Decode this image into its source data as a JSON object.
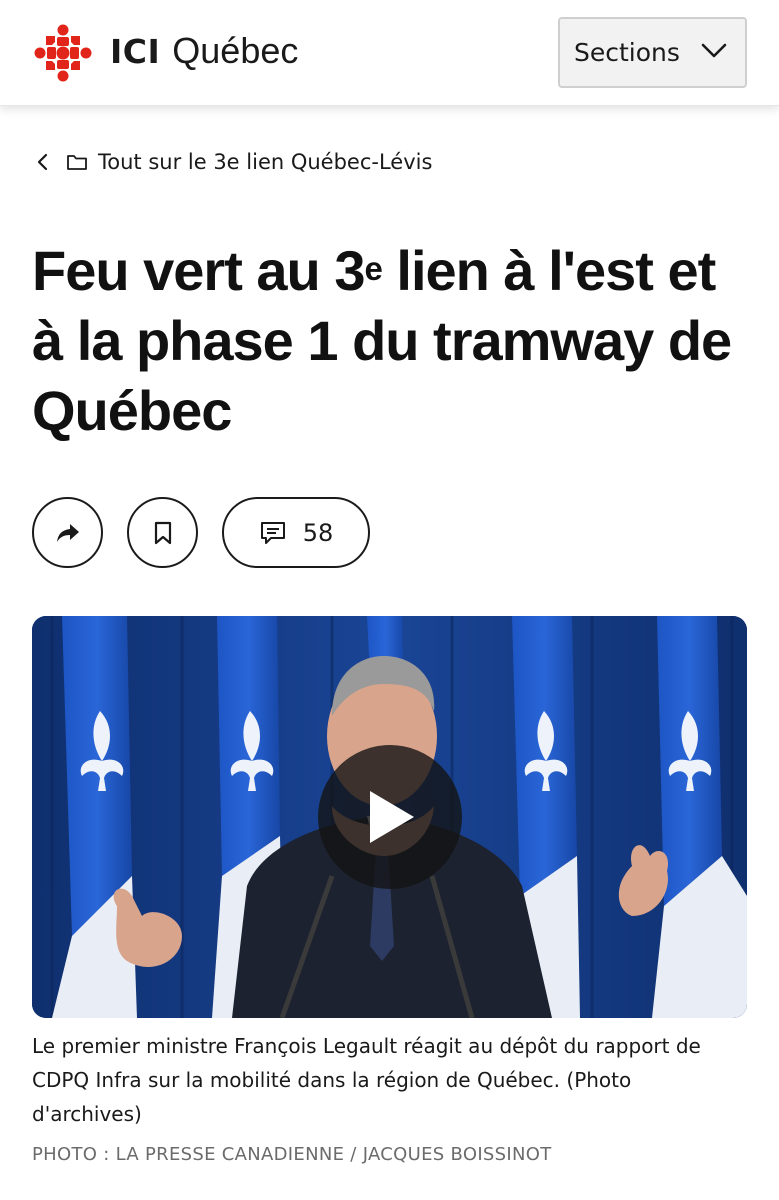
{
  "header": {
    "brand_short": "ICI",
    "brand_region": "Québec",
    "sections_label": "Sections"
  },
  "breadcrumb": {
    "label": "Tout sur le 3e lien Québec-Lévis"
  },
  "article": {
    "title_part1": "Feu vert au 3",
    "title_sup": "e",
    "title_part2": " lien à l'est et à la phase 1 du tramway de Québec",
    "comments_count": "58"
  },
  "media": {
    "caption": "Le premier ministre François Legault réagit au dépôt du rapport de CDPQ Infra sur la mobilité dans la région de Québec. (Photo d'archives)",
    "credit": "PHOTO : LA PRESSE CANADIENNE / JACQUES BOISSINOT"
  },
  "icons": {
    "logo": "radio-canada-gem-logo",
    "sections": "chevron-down-icon",
    "back": "chevron-left-icon",
    "folder": "folder-icon",
    "share": "share-arrow-icon",
    "bookmark": "bookmark-icon",
    "comment": "comment-icon",
    "play": "play-icon"
  },
  "colors": {
    "brand_red": "#e1251b",
    "text": "#1a1a1a",
    "credit_gray": "#6b6b6b"
  }
}
